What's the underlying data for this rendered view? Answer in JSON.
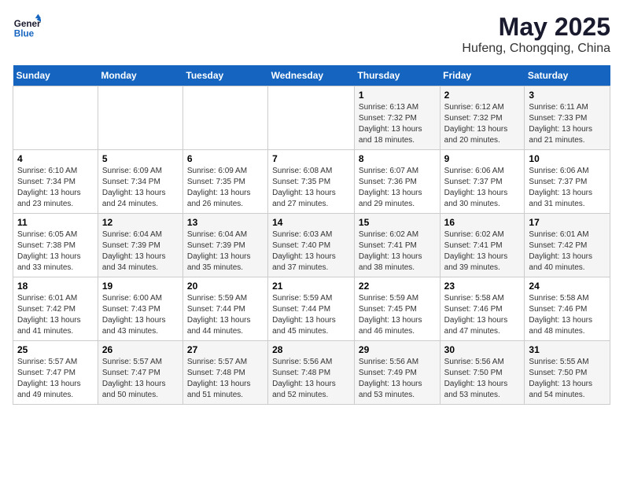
{
  "header": {
    "logo_line1": "General",
    "logo_line2": "Blue",
    "main_title": "May 2025",
    "subtitle": "Hufeng, Chongqing, China"
  },
  "days_of_week": [
    "Sunday",
    "Monday",
    "Tuesday",
    "Wednesday",
    "Thursday",
    "Friday",
    "Saturday"
  ],
  "weeks": [
    [
      {
        "day": "",
        "info": ""
      },
      {
        "day": "",
        "info": ""
      },
      {
        "day": "",
        "info": ""
      },
      {
        "day": "",
        "info": ""
      },
      {
        "day": "1",
        "info": "Sunrise: 6:13 AM\nSunset: 7:32 PM\nDaylight: 13 hours and 18 minutes."
      },
      {
        "day": "2",
        "info": "Sunrise: 6:12 AM\nSunset: 7:32 PM\nDaylight: 13 hours and 20 minutes."
      },
      {
        "day": "3",
        "info": "Sunrise: 6:11 AM\nSunset: 7:33 PM\nDaylight: 13 hours and 21 minutes."
      }
    ],
    [
      {
        "day": "4",
        "info": "Sunrise: 6:10 AM\nSunset: 7:34 PM\nDaylight: 13 hours and 23 minutes."
      },
      {
        "day": "5",
        "info": "Sunrise: 6:09 AM\nSunset: 7:34 PM\nDaylight: 13 hours and 24 minutes."
      },
      {
        "day": "6",
        "info": "Sunrise: 6:09 AM\nSunset: 7:35 PM\nDaylight: 13 hours and 26 minutes."
      },
      {
        "day": "7",
        "info": "Sunrise: 6:08 AM\nSunset: 7:35 PM\nDaylight: 13 hours and 27 minutes."
      },
      {
        "day": "8",
        "info": "Sunrise: 6:07 AM\nSunset: 7:36 PM\nDaylight: 13 hours and 29 minutes."
      },
      {
        "day": "9",
        "info": "Sunrise: 6:06 AM\nSunset: 7:37 PM\nDaylight: 13 hours and 30 minutes."
      },
      {
        "day": "10",
        "info": "Sunrise: 6:06 AM\nSunset: 7:37 PM\nDaylight: 13 hours and 31 minutes."
      }
    ],
    [
      {
        "day": "11",
        "info": "Sunrise: 6:05 AM\nSunset: 7:38 PM\nDaylight: 13 hours and 33 minutes."
      },
      {
        "day": "12",
        "info": "Sunrise: 6:04 AM\nSunset: 7:39 PM\nDaylight: 13 hours and 34 minutes."
      },
      {
        "day": "13",
        "info": "Sunrise: 6:04 AM\nSunset: 7:39 PM\nDaylight: 13 hours and 35 minutes."
      },
      {
        "day": "14",
        "info": "Sunrise: 6:03 AM\nSunset: 7:40 PM\nDaylight: 13 hours and 37 minutes."
      },
      {
        "day": "15",
        "info": "Sunrise: 6:02 AM\nSunset: 7:41 PM\nDaylight: 13 hours and 38 minutes."
      },
      {
        "day": "16",
        "info": "Sunrise: 6:02 AM\nSunset: 7:41 PM\nDaylight: 13 hours and 39 minutes."
      },
      {
        "day": "17",
        "info": "Sunrise: 6:01 AM\nSunset: 7:42 PM\nDaylight: 13 hours and 40 minutes."
      }
    ],
    [
      {
        "day": "18",
        "info": "Sunrise: 6:01 AM\nSunset: 7:42 PM\nDaylight: 13 hours and 41 minutes."
      },
      {
        "day": "19",
        "info": "Sunrise: 6:00 AM\nSunset: 7:43 PM\nDaylight: 13 hours and 43 minutes."
      },
      {
        "day": "20",
        "info": "Sunrise: 5:59 AM\nSunset: 7:44 PM\nDaylight: 13 hours and 44 minutes."
      },
      {
        "day": "21",
        "info": "Sunrise: 5:59 AM\nSunset: 7:44 PM\nDaylight: 13 hours and 45 minutes."
      },
      {
        "day": "22",
        "info": "Sunrise: 5:59 AM\nSunset: 7:45 PM\nDaylight: 13 hours and 46 minutes."
      },
      {
        "day": "23",
        "info": "Sunrise: 5:58 AM\nSunset: 7:46 PM\nDaylight: 13 hours and 47 minutes."
      },
      {
        "day": "24",
        "info": "Sunrise: 5:58 AM\nSunset: 7:46 PM\nDaylight: 13 hours and 48 minutes."
      }
    ],
    [
      {
        "day": "25",
        "info": "Sunrise: 5:57 AM\nSunset: 7:47 PM\nDaylight: 13 hours and 49 minutes."
      },
      {
        "day": "26",
        "info": "Sunrise: 5:57 AM\nSunset: 7:47 PM\nDaylight: 13 hours and 50 minutes."
      },
      {
        "day": "27",
        "info": "Sunrise: 5:57 AM\nSunset: 7:48 PM\nDaylight: 13 hours and 51 minutes."
      },
      {
        "day": "28",
        "info": "Sunrise: 5:56 AM\nSunset: 7:48 PM\nDaylight: 13 hours and 52 minutes."
      },
      {
        "day": "29",
        "info": "Sunrise: 5:56 AM\nSunset: 7:49 PM\nDaylight: 13 hours and 53 minutes."
      },
      {
        "day": "30",
        "info": "Sunrise: 5:56 AM\nSunset: 7:50 PM\nDaylight: 13 hours and 53 minutes."
      },
      {
        "day": "31",
        "info": "Sunrise: 5:55 AM\nSunset: 7:50 PM\nDaylight: 13 hours and 54 minutes."
      }
    ]
  ]
}
